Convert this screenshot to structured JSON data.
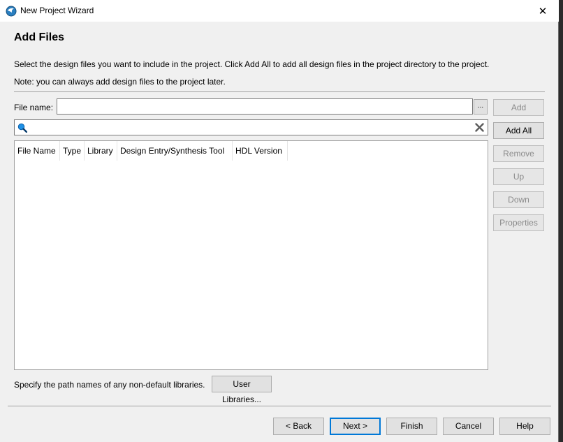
{
  "window": {
    "title": "New Project Wizard",
    "close_glyph": "✕"
  },
  "page": {
    "heading": "Add Files",
    "description": "Select the design files you want to include in the project. Click Add All to add all design files in the project directory to the project.",
    "note": "Note: you can always add design files to the project later."
  },
  "file_name": {
    "label": "File name:",
    "value": "",
    "browse_label": "..."
  },
  "filter": {
    "value": ""
  },
  "table": {
    "columns": [
      "File Name",
      "Type",
      "Library",
      "Design Entry/Synthesis Tool",
      "HDL Version"
    ],
    "rows": []
  },
  "side_buttons": {
    "add": "Add",
    "add_all": "Add All",
    "remove": "Remove",
    "up": "Up",
    "down": "Down",
    "properties": "Properties"
  },
  "libraries": {
    "label": "Specify the path names of any non-default libraries.",
    "button": "User Libraries..."
  },
  "nav": {
    "back": "< Back",
    "next": "Next >",
    "finish": "Finish",
    "cancel": "Cancel",
    "help": "Help"
  },
  "colors": {
    "accent": "#0078d7",
    "search_icon": "#1e90e6",
    "app_icon": "#2a7fc1"
  }
}
